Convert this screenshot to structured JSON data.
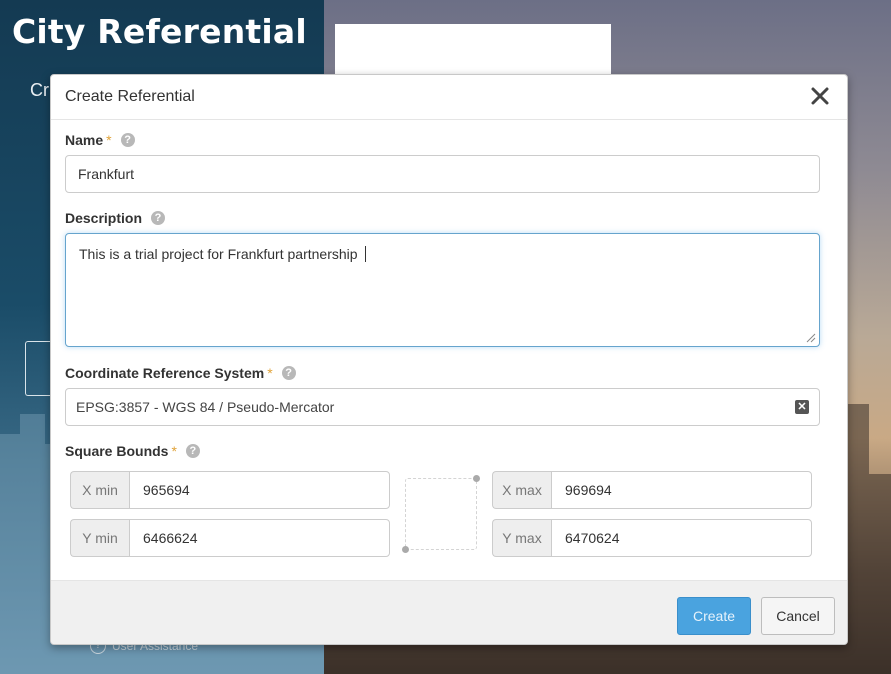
{
  "background": {
    "app_title": "City Referential",
    "app_subtitle": "Cr",
    "help_link_label": "User Assistance"
  },
  "modal": {
    "title": "Create Referential",
    "fields": {
      "name": {
        "label": "Name",
        "required_mark": "*",
        "value": "Frankfurt"
      },
      "description": {
        "label": "Description",
        "value": "This is a trial project for Frankfurt partnership "
      },
      "crs": {
        "label": "Coordinate Reference System",
        "required_mark": "*",
        "value": "EPSG:3857 - WGS 84 / Pseudo-Mercator"
      },
      "bounds": {
        "label": "Square Bounds",
        "required_mark": "*",
        "x_min": {
          "label": "X min",
          "value": "965694"
        },
        "y_min": {
          "label": "Y min",
          "value": "6466624"
        },
        "x_max": {
          "label": "X max",
          "value": "969694"
        },
        "y_max": {
          "label": "Y max",
          "value": "6470624"
        }
      }
    },
    "buttons": {
      "create": "Create",
      "cancel": "Cancel"
    }
  },
  "colors": {
    "primary_button": "#4aa3df",
    "required_asterisk": "#e0a238",
    "focus_border": "#66a4cd"
  },
  "icons": {
    "close": "close-icon",
    "help": "question-circle-icon",
    "clear": "clear-x-icon"
  }
}
